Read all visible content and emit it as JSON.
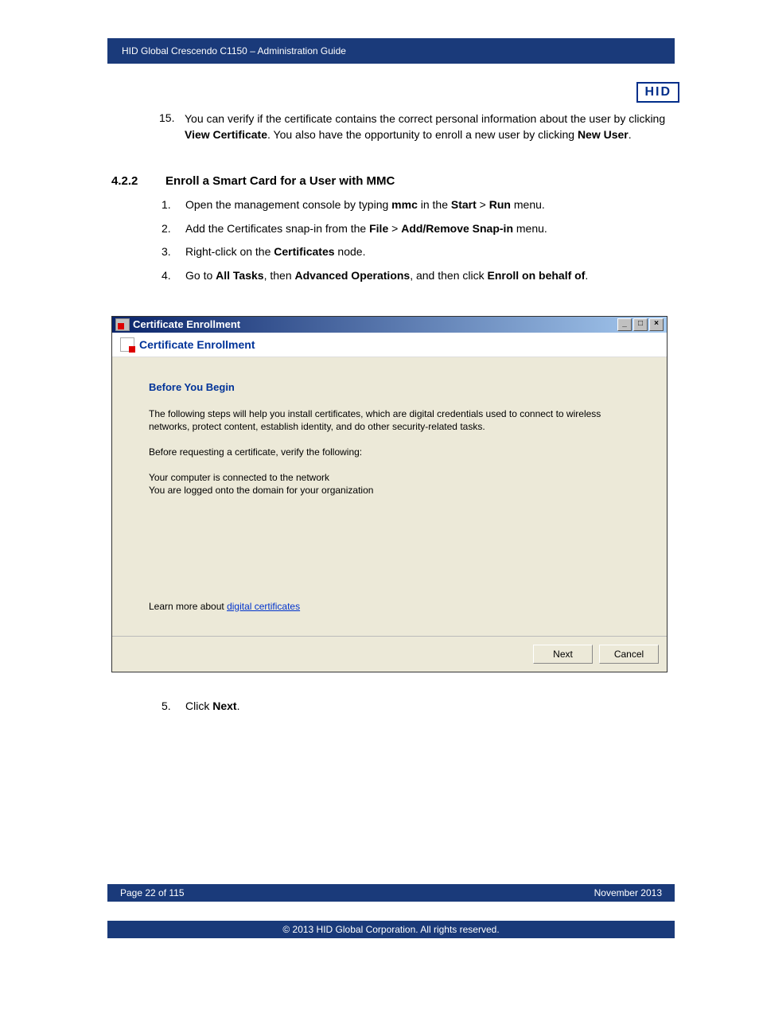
{
  "header": {
    "title": "HID Global Crescendo C1150  – Administration Guide",
    "logo": "HID"
  },
  "para15": {
    "num": "15.",
    "text_pre": "You can verify if the certificate contains the correct personal information about the user by clicking ",
    "bold1": "View Certificate",
    "mid1": ". You also have the opportunity to enroll a new user by clicking ",
    "bold2": "New User",
    "end": "."
  },
  "section": {
    "num": "4.2.2",
    "title": "Enroll a Smart Card for a User with MMC"
  },
  "steps": {
    "s1": {
      "n": "1.",
      "a": "Open the management console by typing ",
      "b1": "mmc",
      "b": " in the ",
      "b2": "Start",
      "c": " > ",
      "b3": "Run",
      "d": " menu."
    },
    "s2": {
      "n": "2.",
      "a": "Add the Certificates snap-in from the ",
      "b1": "File",
      "b": " > ",
      "b2": "Add/Remove Snap-in",
      "c": " menu."
    },
    "s3": {
      "n": "3.",
      "a": "Right-click on the ",
      "b1": "Certificates",
      "b": " node."
    },
    "s4": {
      "n": "4.",
      "a": "Go to ",
      "b1": "All Tasks",
      "b": ", then ",
      "b2": "Advanced Operations",
      "c": ", and then click ",
      "b3": "Enroll on behalf of",
      "d": "."
    },
    "s5": {
      "n": "5.",
      "a": "Click ",
      "b1": "Next",
      "b": "."
    }
  },
  "dialog": {
    "title": "Certificate Enrollment",
    "subheader": "Certificate Enrollment",
    "heading": "Before You Begin",
    "p1": "The following steps will help you install certificates, which are digital credentials used to connect to wireless networks, protect content, establish identity, and do other security-related tasks.",
    "p2": "Before requesting a certificate, verify the following:",
    "p3a": "Your computer is connected to the network",
    "p3b": "You are logged onto the domain for your organization",
    "learn_prefix": "Learn more about ",
    "learn_link": "digital certificates",
    "btn_next": "Next",
    "btn_cancel": "Cancel",
    "win_min": "_",
    "win_max": "□",
    "win_close": "×"
  },
  "footer": {
    "page": "Page 22 of 115",
    "date": "November 2013",
    "copyright": "© 2013 HID Global Corporation. All rights reserved."
  }
}
